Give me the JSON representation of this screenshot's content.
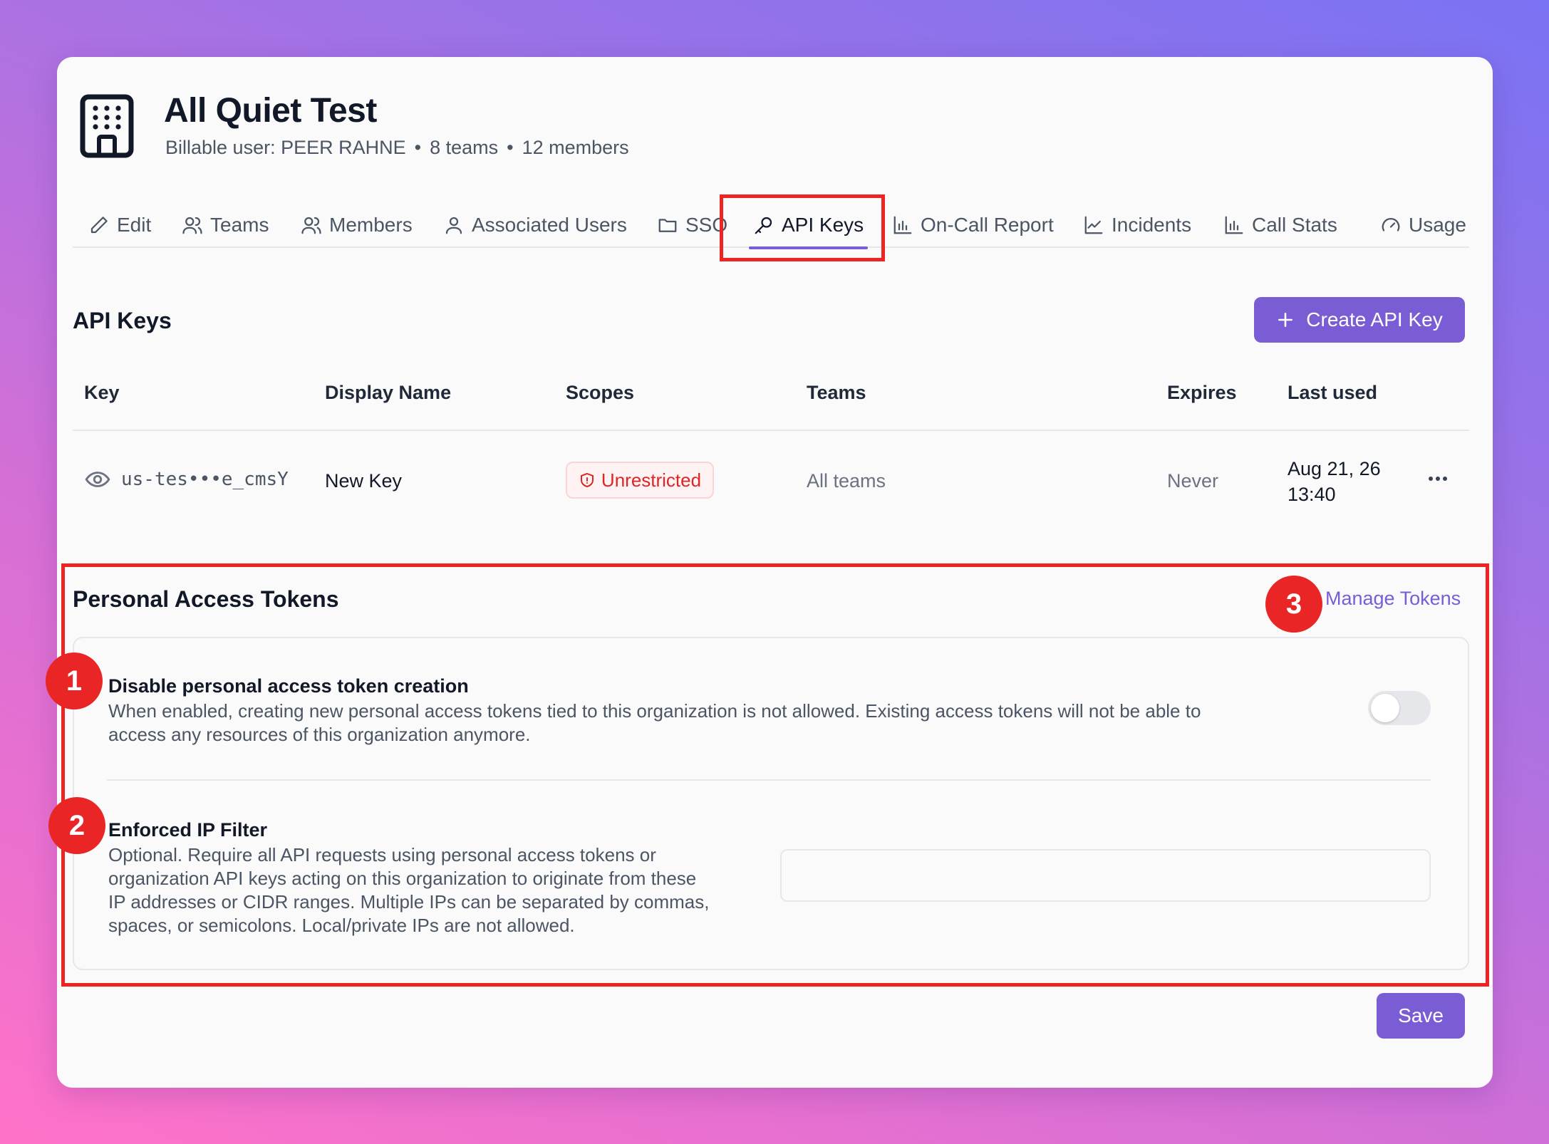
{
  "org": {
    "name": "All Quiet Test",
    "billable_user": "Billable user: PEER RAHNE",
    "teams_count": "8 teams",
    "members_count": "12 members"
  },
  "tabs": [
    {
      "label": "Edit",
      "icon": "pencil-icon"
    },
    {
      "label": "Teams",
      "icon": "users-icon"
    },
    {
      "label": "Members",
      "icon": "users-icon"
    },
    {
      "label": "Associated Users",
      "icon": "user-icon"
    },
    {
      "label": "SSO",
      "icon": "folder-icon"
    },
    {
      "label": "API Keys",
      "icon": "key-icon",
      "active": true
    },
    {
      "label": "On-Call Report",
      "icon": "bar-chart-icon"
    },
    {
      "label": "Incidents",
      "icon": "line-chart-icon"
    },
    {
      "label": "Call Stats",
      "icon": "bar-chart-icon"
    },
    {
      "label": "Usage",
      "icon": "gauge-icon"
    }
  ],
  "api_keys": {
    "title": "API Keys",
    "create_label": "Create API Key",
    "columns": [
      "Key",
      "Display Name",
      "Scopes",
      "Teams",
      "Expires",
      "Last used"
    ],
    "rows": [
      {
        "key": "us-tes•••e_cmsY",
        "display_name": "New Key",
        "scope": "Unrestricted",
        "teams": "All teams",
        "expires": "Never",
        "last_used_date": "Aug 21, 26",
        "last_used_time": "13:40"
      }
    ]
  },
  "pat": {
    "title": "Personal Access Tokens",
    "manage_label": "Manage Tokens",
    "disable": {
      "title": "Disable personal access token creation",
      "desc_line1": "When enabled, creating new personal access tokens tied to this organization is not allowed. Existing access tokens will not be able to",
      "desc_line2": "access any resources of this organization anymore.",
      "enabled": false
    },
    "ip_filter": {
      "title": "Enforced IP Filter",
      "desc_lines": [
        "Optional. Require all API requests using personal access tokens or",
        "organization API keys acting on this organization to originate from these",
        "IP addresses or CIDR ranges. Multiple IPs can be separated by commas,",
        "spaces, or semicolons. Local/private IPs are not allowed."
      ],
      "value": "",
      "placeholder": ""
    }
  },
  "save_label": "Save",
  "annotations": [
    "1",
    "2",
    "3"
  ],
  "colors": {
    "accent": "#7a5cd5",
    "annotation_red": "#e92525",
    "danger_text": "#dc2626"
  }
}
